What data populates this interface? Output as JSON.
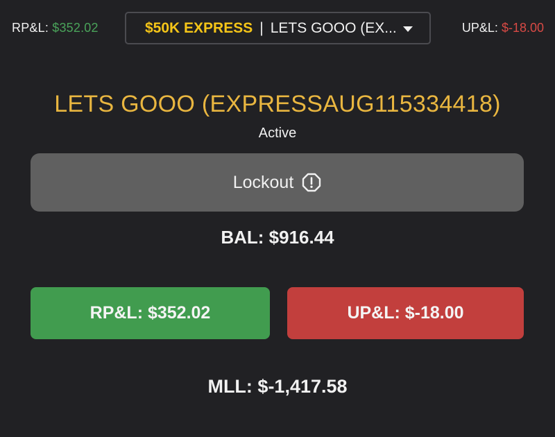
{
  "header": {
    "rpl_label": "RP&L:",
    "rpl_value": "$352.02",
    "upl_label": "UP&L:",
    "upl_value": "$-18.00",
    "account_select": {
      "plan": "$50K EXPRESS",
      "separator": "|",
      "name": "LETS GOOO (EX..."
    }
  },
  "account": {
    "title": "LETS GOOO (EXPRESSAUG115334418)",
    "status": "Active"
  },
  "lockout": {
    "label": "Lockout",
    "icon": "alert-octagon-icon"
  },
  "balance": "BAL: $916.44",
  "stats": {
    "rpl": "RP&L: $352.02",
    "upl": "UP&L: $-18.00"
  },
  "mll": "MLL: $-1,417.58",
  "colors": {
    "background": "#212124",
    "title_gold": "#e9b640",
    "plan_yellow": "#f5c518",
    "positive_green": "#419c4f",
    "negative_red": "#c23f3d",
    "lockout_gray": "#606060"
  }
}
